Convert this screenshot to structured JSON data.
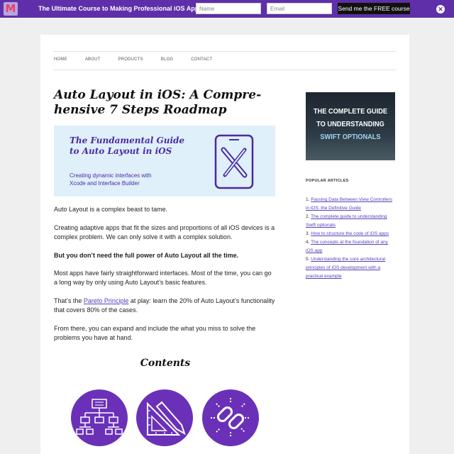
{
  "topbar": {
    "logo_letter": "M",
    "promo": "The Ultimate Course to Making Professional iOS Apps",
    "name_placeholder": "Name",
    "email_placeholder": "Email",
    "cta": "Send me the FREE course",
    "close": "✕",
    "color": "#5e2fa8"
  },
  "nav": {
    "items": [
      "HOME",
      "ABOUT",
      "PRODUCTS",
      "BLOG",
      "CONTACT"
    ]
  },
  "article": {
    "title": "Auto Layout in iOS: A Compre­hensive 7 Steps Roadmap",
    "hero": {
      "title": "The Fundamental Guide to Auto Layout in iOS",
      "subtitle": "Creating dynamic interfaces with Xcode and Interface Builder"
    },
    "p1": "Auto Layout is a complex beast to tame.",
    "p2": "Creating adaptive apps that fit the sizes and proportions of all iOS devices is a complex problem. We can only solve it with a complex solution.",
    "p3": "But you don’t need the full power of Auto Layout all the time.",
    "p4": "Most apps have fairly straightforward interfaces. Most of the time, you can go a long way by only using Auto Layout’s basic features.",
    "p5_before": "That’s the ",
    "p5_link": "Pareto Principle",
    "p5_after": " at play: learn the 20% of Auto Layout’s function­ality that covers 80% of the cases.",
    "p6": "From there, you can expand and include the what you miss to solve the problems you have at hand.",
    "contents_title": "Contents"
  },
  "sidebar": {
    "book_line1": "THE COMPLETE GUIDE",
    "book_line2": "TO UNDERSTANDING",
    "book_line3": "SWIFT OPTIONALS",
    "popular_title": "POPULAR ARTICLES",
    "articles": [
      {
        "num": "1.",
        "text": "Passing Data Between View Con­trollers in iOS: the Definitive Guide"
      },
      {
        "num": "2.",
        "text": "The complete guide to understanding Swift optionals"
      },
      {
        "num": "3.",
        "text": "How to structure the code of iOS apps"
      },
      {
        "num": "4.",
        "text": "The concepts at the foundation of any iOS app"
      },
      {
        "num": "5.",
        "text": "Understanding the core architectural principles of iOS development with a practical example"
      }
    ]
  },
  "icons": {
    "contents": [
      "hierarchy-icon",
      "design-tools-icon",
      "broken-chain-icon"
    ]
  }
}
